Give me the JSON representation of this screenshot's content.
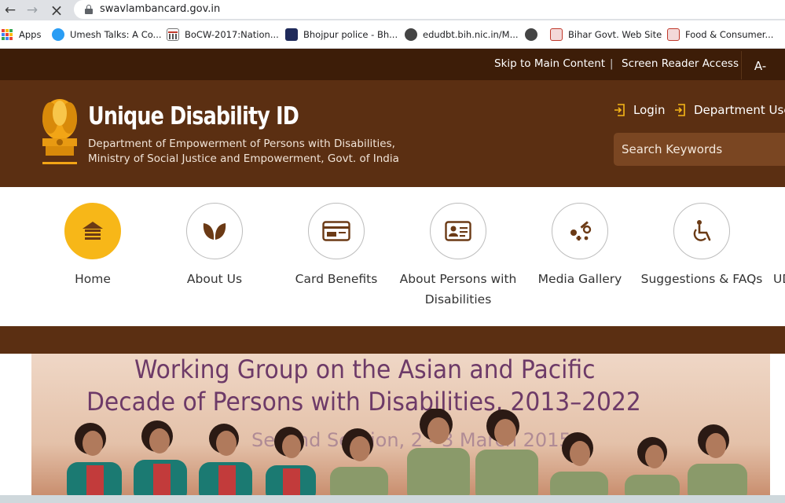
{
  "browser": {
    "url": "swavlambancard.gov.in",
    "bookmarks": [
      {
        "label": "Apps"
      },
      {
        "label": "Umesh Talks: A Co..."
      },
      {
        "label": "BoCW-2017:Nation..."
      },
      {
        "label": "Bhojpur police - Bh..."
      },
      {
        "label": "edudbt.bih.nic.in/M..."
      },
      {
        "label": ""
      },
      {
        "label": "Bihar Govt. Web Site"
      },
      {
        "label": "Food & Consumer..."
      }
    ]
  },
  "topbar": {
    "skip_link": "Skip to Main Content",
    "separator": "|",
    "screen_reader": "Screen Reader Access",
    "font_decrease": "A-"
  },
  "header": {
    "title": "Unique Disability ID",
    "dept_line1": "Department of Empowerment of Persons with Disabilities,",
    "dept_line2": "Ministry of Social Justice and Empowerment, Govt. of India",
    "login": "Login",
    "department_user": "Department User",
    "search_placeholder": "Search Keywords"
  },
  "nav": {
    "items": [
      {
        "label": "Home",
        "icon": "home-icon",
        "active": true
      },
      {
        "label": "About Us",
        "icon": "leaf-icon"
      },
      {
        "label": "Card Benefits",
        "icon": "card-icon"
      },
      {
        "label": "About Persons with Disabilities",
        "icon": "id-card-icon"
      },
      {
        "label": "Media Gallery",
        "icon": "media-icon"
      },
      {
        "label": "Suggestions & FAQs",
        "icon": "wheelchair-icon"
      },
      {
        "label": "UD"
      }
    ]
  },
  "banner": {
    "line1": "Working Group on the Asian and Pacific",
    "line2": "Decade of Persons with Disabilities, 2013–2022",
    "line3": "Second Session, 2 - 3 March 2015"
  },
  "colors": {
    "top_strip": "#3d1d08",
    "header": "#5b2f12",
    "active_nav": "#f7b718",
    "accent_text": "#6d3a68"
  }
}
